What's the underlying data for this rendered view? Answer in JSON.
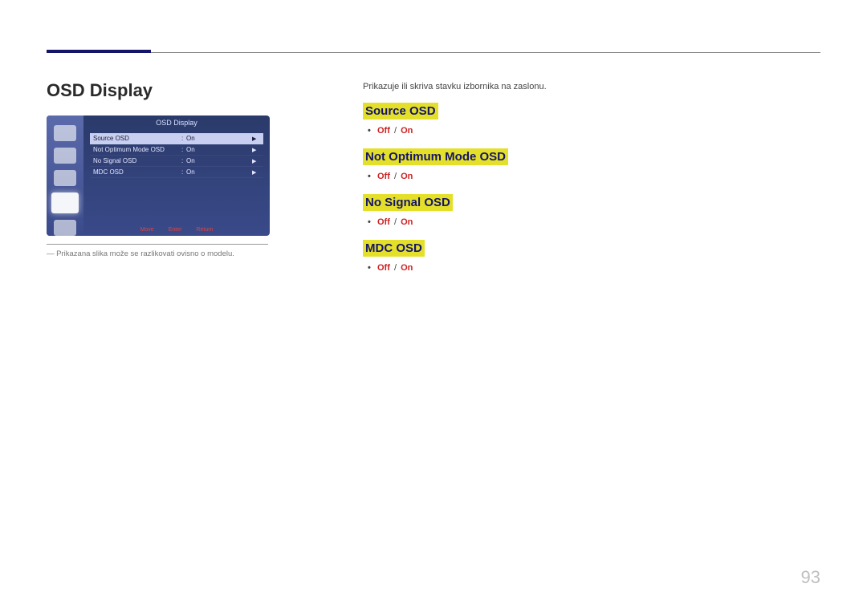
{
  "section_title": "OSD Display",
  "osd_panel": {
    "title": "OSD Display",
    "rows": [
      {
        "label": "Source OSD",
        "value": "On"
      },
      {
        "label": "Not Optimum Mode OSD",
        "value": "On"
      },
      {
        "label": "No Signal OSD",
        "value": "On"
      },
      {
        "label": "MDC OSD",
        "value": "On"
      }
    ],
    "footer": {
      "move": "Move",
      "enter": "Enter",
      "return": "Return"
    }
  },
  "note_prefix": "―",
  "note": "Prikazana slika može se razlikovati ovisno o modelu.",
  "intro": "Prikazuje ili skriva stavku izbornika na zaslonu.",
  "settings": [
    {
      "heading": "Source OSD",
      "off": "Off",
      "on": "On"
    },
    {
      "heading": "Not Optimum Mode OSD",
      "off": "Off",
      "on": "On"
    },
    {
      "heading": "No Signal OSD",
      "off": "Off",
      "on": "On"
    },
    {
      "heading": "MDC OSD",
      "off": "Off",
      "on": "On"
    }
  ],
  "page_number": "93"
}
